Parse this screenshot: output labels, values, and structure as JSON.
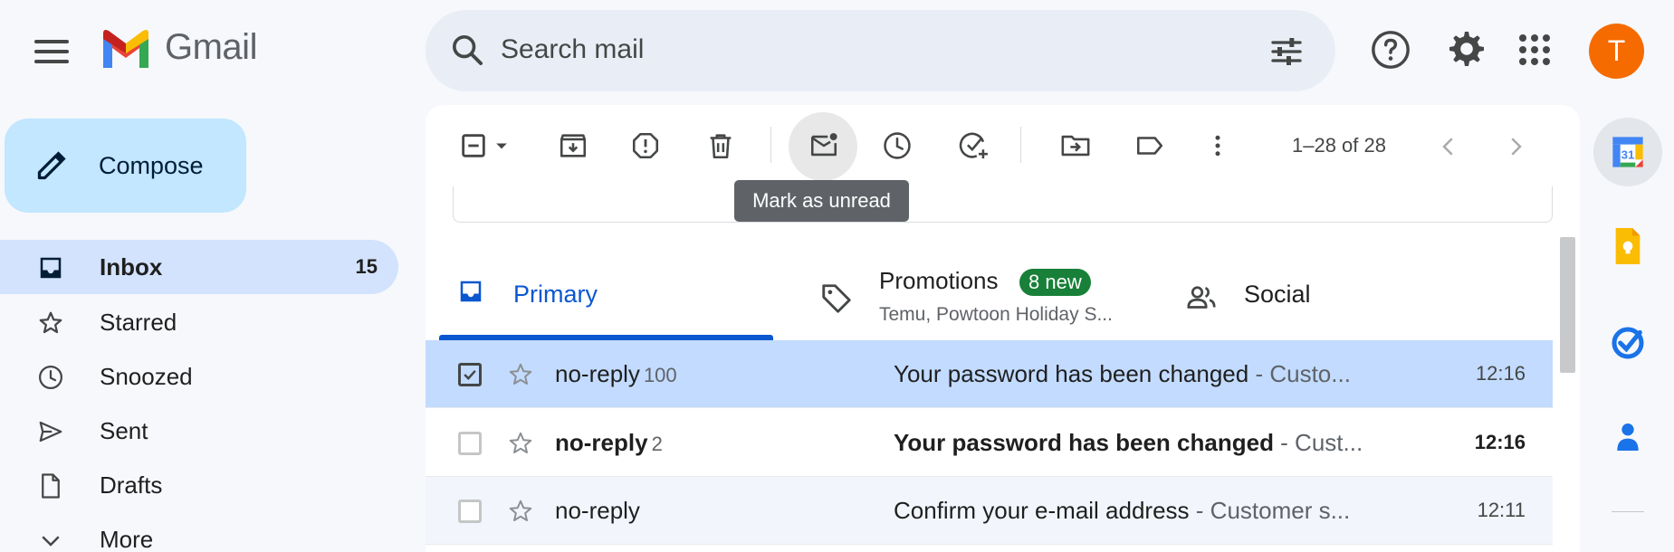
{
  "header": {
    "app_name": "Gmail",
    "search_placeholder": "Search mail",
    "avatar_letter": "T"
  },
  "compose": {
    "label": "Compose"
  },
  "nav": [
    {
      "label": "Inbox",
      "count": "15",
      "icon": "inbox-icon",
      "active": true
    },
    {
      "label": "Starred",
      "count": "",
      "icon": "star-icon"
    },
    {
      "label": "Snoozed",
      "count": "",
      "icon": "clock-icon"
    },
    {
      "label": "Sent",
      "count": "",
      "icon": "send-icon"
    },
    {
      "label": "Drafts",
      "count": "",
      "icon": "draft-icon"
    },
    {
      "label": "More",
      "count": "",
      "icon": "chevron-down-icon"
    }
  ],
  "toolbar": {
    "paging": "1–28 of 28",
    "tooltip": "Mark as unread",
    "icons": [
      "select-checkbox-icon",
      "select-dropdown-icon",
      "archive-icon",
      "report-spam-icon",
      "delete-icon",
      "mark-unread-icon",
      "snooze-icon",
      "add-to-tasks-icon",
      "move-to-icon",
      "label-icon",
      "more-vert-icon"
    ]
  },
  "tabs": {
    "primary": {
      "label": "Primary"
    },
    "promotions": {
      "label": "Promotions",
      "badge": "8 new",
      "subtitle": "Temu, Powtoon Holiday S..."
    },
    "social": {
      "label": "Social"
    }
  },
  "emails": [
    {
      "sender": "no-reply",
      "count": "100",
      "subject": "Your password has been changed",
      "snippet": " - Custo...",
      "time": "12:16",
      "selected": true,
      "unread": false
    },
    {
      "sender": "no-reply",
      "count": "2",
      "subject": "Your password has been changed",
      "snippet": " - Cust...",
      "time": "12:16",
      "selected": false,
      "unread": true
    },
    {
      "sender": "no-reply",
      "count": "",
      "subject": "Confirm your e-mail address",
      "snippet": " - Customer s...",
      "time": "12:11",
      "selected": false,
      "unread": false
    }
  ],
  "side_apps": [
    "calendar-icon",
    "keep-icon",
    "tasks-icon",
    "contacts-icon"
  ],
  "colors": {
    "accent": "#0b57d0",
    "compose_bg": "#c2e7ff",
    "selected_row": "#c2dbff",
    "badge_green": "#188038",
    "avatar": "#f56b00"
  }
}
